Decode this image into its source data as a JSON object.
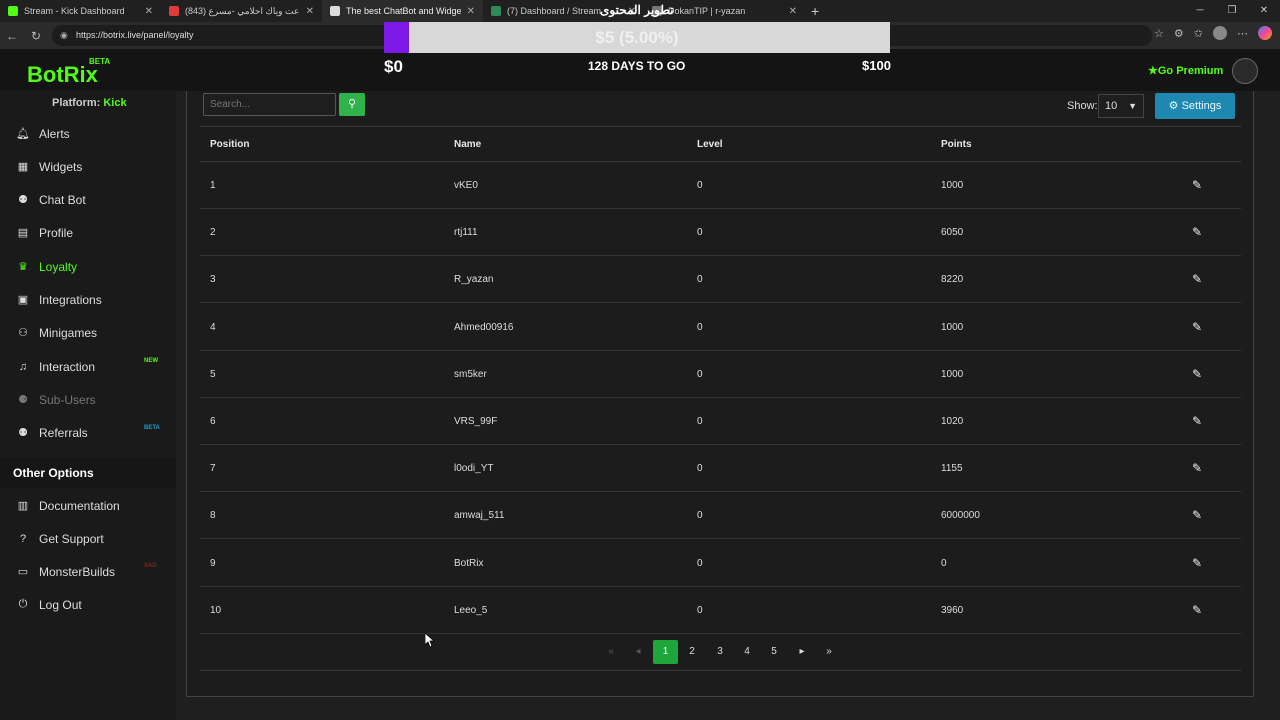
{
  "browser": {
    "tabs": [
      {
        "title": "Stream - Kick Dashboard",
        "color": "#53fc18"
      },
      {
        "title": "شاعت وياك احلامي -مسرع (843)",
        "color": "#e23b3b"
      },
      {
        "title": "The best ChatBot and Widgets fo",
        "color": "#dddddd"
      },
      {
        "title": "(7) Dashboard / Stream",
        "color": "#2e8b57"
      },
      {
        "title": "DokanTIP | r-yazan",
        "color": "#777777"
      }
    ],
    "url": "https://botrix.live/panel/loyalty"
  },
  "overlay": {
    "arabic_title": "تطوير المحتوى",
    "goal_text": "$5 (5.00%)",
    "goal_percent": 5,
    "start": "$0",
    "days": "128 DAYS TO GO",
    "end": "$100"
  },
  "header": {
    "logo": "BotRix",
    "logo_badge": "BETA",
    "premium": "Go Premium"
  },
  "sidebar": {
    "platform_label": "Platform:",
    "platform_value": "Kick",
    "items": [
      {
        "label": "Alerts",
        "icon": "bell-icon"
      },
      {
        "label": "Widgets",
        "icon": "grid-icon"
      },
      {
        "label": "Chat Bot",
        "icon": "robot-icon"
      },
      {
        "label": "Profile",
        "icon": "id-card-icon"
      },
      {
        "label": "Loyalty",
        "icon": "trophy-icon"
      },
      {
        "label": "Integrations",
        "icon": "integrations-icon"
      },
      {
        "label": "Minigames",
        "icon": "gamepad-icon"
      },
      {
        "label": "Interaction",
        "icon": "music-icon",
        "badge": "NEW"
      },
      {
        "label": "Sub-Users",
        "icon": "users-icon"
      },
      {
        "label": "Referrals",
        "icon": "referrals-icon",
        "badge": "BETA"
      }
    ],
    "other_title": "Other Options",
    "other_items": [
      {
        "label": "Documentation",
        "icon": "book-icon"
      },
      {
        "label": "Get Support",
        "icon": "question-icon"
      },
      {
        "label": "MonsterBuilds",
        "icon": "laptop-icon",
        "badge": "SAD"
      },
      {
        "label": "Log Out",
        "icon": "logout-icon"
      }
    ]
  },
  "toolbar": {
    "search_placeholder": "Search...",
    "show_label": "Show:",
    "show_value": "10",
    "settings_label": "Settings"
  },
  "table": {
    "headers": [
      "Position",
      "Name",
      "Level",
      "Points"
    ],
    "rows": [
      [
        "1",
        "vKE0",
        "0",
        "1000"
      ],
      [
        "2",
        "rtj111",
        "0",
        "6050"
      ],
      [
        "3",
        "R_yazan",
        "0",
        "8220"
      ],
      [
        "4",
        "Ahmed00916",
        "0",
        "1000"
      ],
      [
        "5",
        "sm5ker",
        "0",
        "1000"
      ],
      [
        "6",
        "VRS_99F",
        "0",
        "1020"
      ],
      [
        "7",
        "l0odi_YT",
        "0",
        "1155"
      ],
      [
        "8",
        "amwaj_511",
        "0",
        "6000000"
      ],
      [
        "9",
        "BotRix",
        "0",
        "0"
      ],
      [
        "10",
        "Leeo_5",
        "0",
        "3960"
      ]
    ]
  },
  "pagination": {
    "pages": [
      "1",
      "2",
      "3",
      "4",
      "5"
    ],
    "current": "1"
  }
}
